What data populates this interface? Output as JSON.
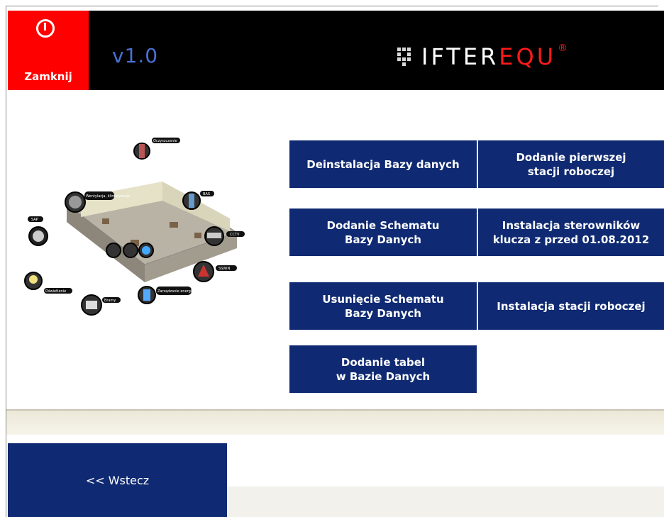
{
  "header": {
    "close_label": "Zamknij",
    "version": "v1.0",
    "logo_part1": "IFTER",
    "logo_part2": "EQU",
    "logo_reg": "®"
  },
  "buttons": {
    "uninstall_db": "Deinstalacja Bazy danych",
    "add_first_station": "Dodanie pierwszej\nstacji roboczej",
    "add_schema": "Dodanie Schematu\nBazy Danych",
    "install_drivers": "Instalacja sterowników\nklucza z przed 01.08.2012",
    "remove_schema": "Usunięcie Schematu\nBazy Danych",
    "install_station": "Instalacja stacji roboczej",
    "add_tables": "Dodanie tabel\nw Bazie Danych"
  },
  "illustration": {
    "labels": [
      "SAP",
      "Wentylacja, klimatyzacja",
      "Oczyszczanie",
      "BAS",
      "CCTV",
      "SSWiN",
      "Oświetlenie",
      "Bramy",
      "Zarządzanie energią"
    ]
  },
  "footer": {
    "back_label": "<< Wstecz"
  },
  "colors": {
    "accent_red": "#ff0000",
    "button_blue": "#0f2a72",
    "header_black": "#000000"
  }
}
